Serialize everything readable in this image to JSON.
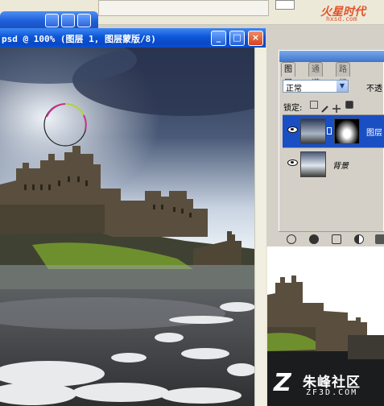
{
  "doc": {
    "title": "psd @ 100% (图层 1, 图层蒙版/8)",
    "btn_min": "_",
    "btn_max": "□",
    "btn_close": "×"
  },
  "logo": {
    "text": "火星时代",
    "url": "hxsd.com"
  },
  "layers_panel": {
    "tabs": [
      "图层",
      "通道",
      "路径"
    ],
    "blend_mode": "正常",
    "opacity_label": "不透",
    "lock_label": "锁定:",
    "layers": [
      {
        "name": "图层",
        "selected": true
      },
      {
        "name": "背景",
        "selected": false
      }
    ]
  },
  "watermark": {
    "logo_glyph": "Z",
    "title": "朱峰社区",
    "url": "ZF3D.COM"
  },
  "colors": {
    "titlebar": "#0c56d8",
    "selection": "#1a4fc4",
    "logo": "#e0532b"
  }
}
